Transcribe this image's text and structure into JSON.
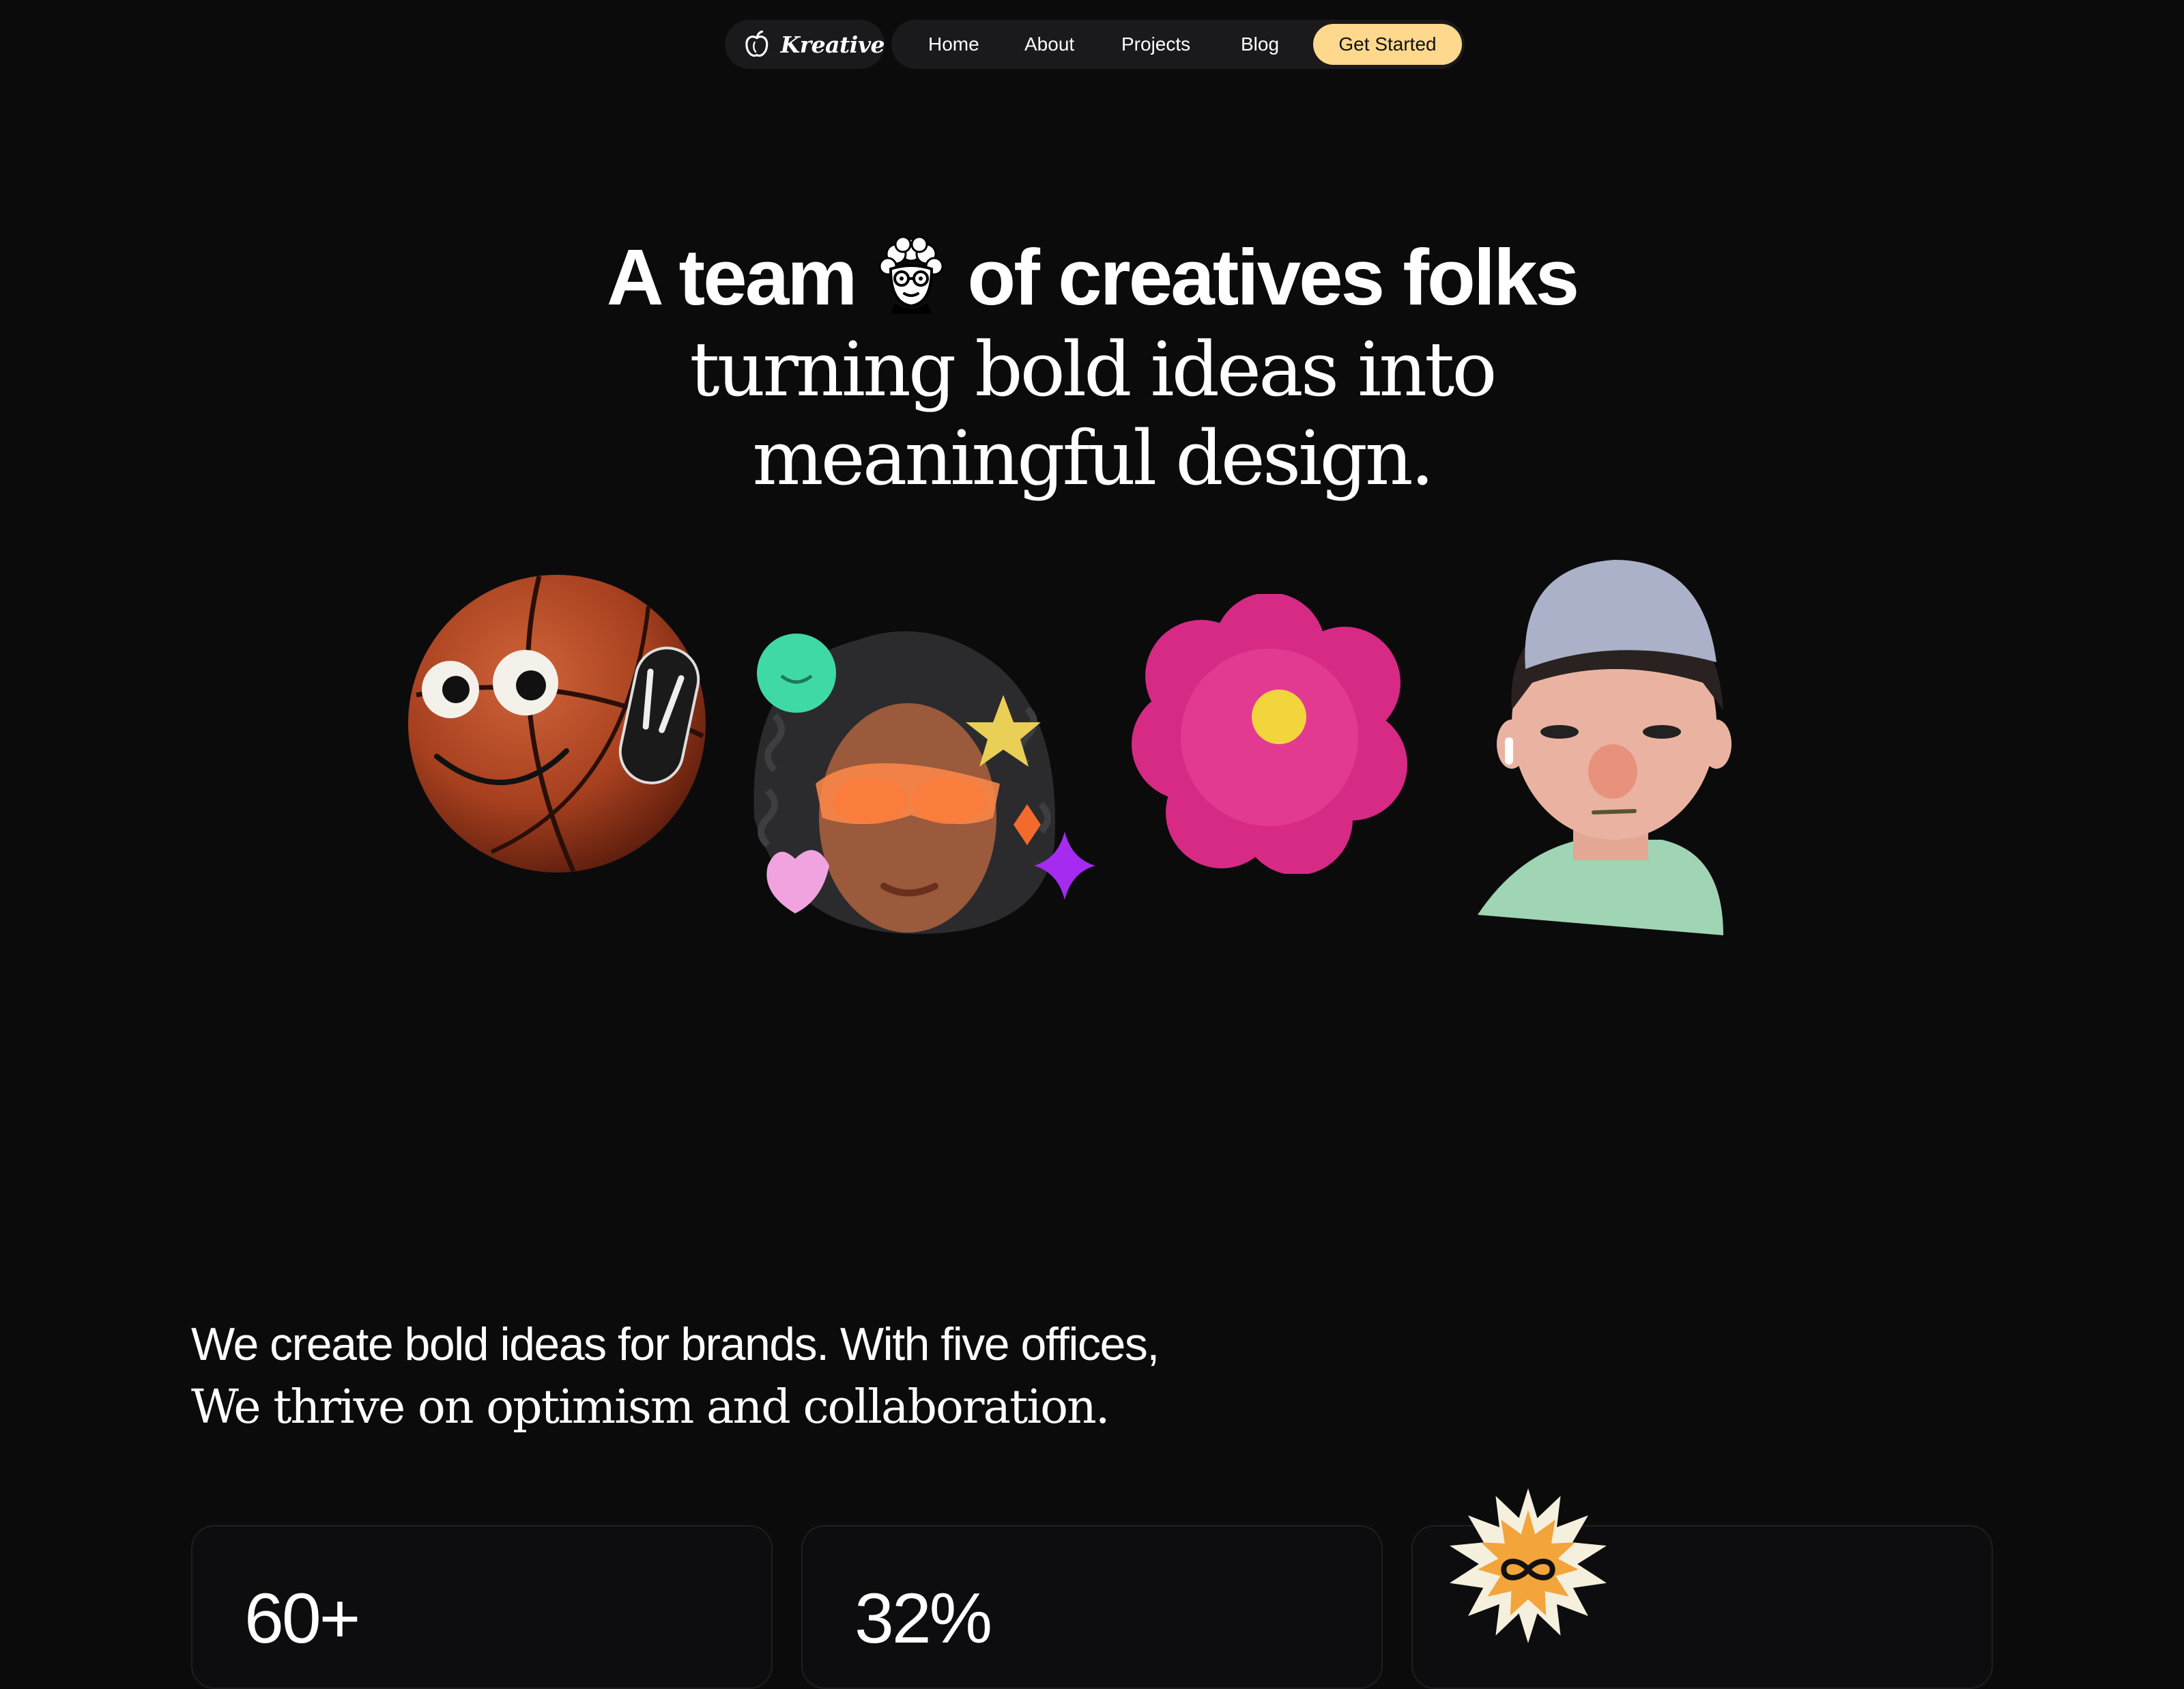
{
  "nav": {
    "brand": "Kreative",
    "links": [
      "Home",
      "About",
      "Projects",
      "Blog"
    ],
    "cta": "Get Started"
  },
  "hero": {
    "line1_part1": "A team",
    "line1_part2": "of creatives folks",
    "line2": "turning bold ideas into",
    "line3": "meaningful design."
  },
  "about": {
    "line1": "We create bold ideas for brands. With five offices,",
    "line2": "We thrive on optimism and collaboration."
  },
  "stats": [
    {
      "value": "60+"
    },
    {
      "value": "32%"
    },
    {
      "value": "",
      "badge_icon": "infinity-icon"
    }
  ],
  "colors": {
    "background": "#0b0b0c",
    "pill": "#1a1a1c",
    "cta": "#fdd88d",
    "badge": "#f3a43a"
  }
}
